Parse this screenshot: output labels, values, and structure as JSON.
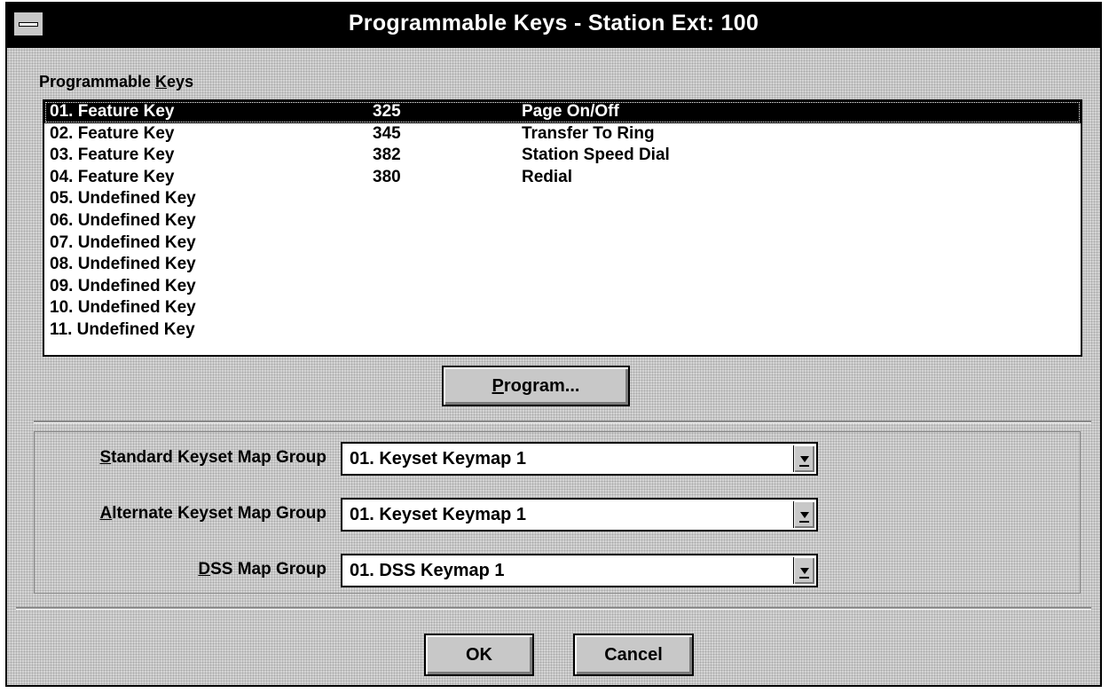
{
  "window": {
    "title": "Programmable Keys - Station Ext:  100"
  },
  "keys_group": {
    "label_prefix": "Programmable ",
    "label_mnemonic": "K",
    "label_suffix": "eys",
    "rows": [
      {
        "key": "01. Feature Key",
        "code": "325",
        "desc": "Page On/Off",
        "selected": true
      },
      {
        "key": "02. Feature Key",
        "code": "345",
        "desc": "Transfer To Ring"
      },
      {
        "key": "03. Feature Key",
        "code": "382",
        "desc": "Station Speed Dial"
      },
      {
        "key": "04. Feature Key",
        "code": "380",
        "desc": "Redial"
      },
      {
        "key": "05. Undefined Key",
        "code": "",
        "desc": ""
      },
      {
        "key": "06. Undefined Key",
        "code": "",
        "desc": ""
      },
      {
        "key": "07. Undefined Key",
        "code": "",
        "desc": ""
      },
      {
        "key": "08. Undefined Key",
        "code": "",
        "desc": ""
      },
      {
        "key": "09. Undefined Key",
        "code": "",
        "desc": ""
      },
      {
        "key": "10. Undefined Key",
        "code": "",
        "desc": ""
      },
      {
        "key": "11. Undefined Key",
        "code": "",
        "desc": ""
      }
    ],
    "program_button": {
      "mnemonic": "P",
      "rest": "rogram..."
    }
  },
  "map_groups": {
    "standard": {
      "mnemonic": "S",
      "rest": "tandard Keyset Map Group",
      "value": "01.  Keyset Keymap  1"
    },
    "alternate": {
      "mnemonic": "A",
      "rest": "lternate Keyset Map Group",
      "value": "01.  Keyset Keymap  1"
    },
    "dss": {
      "mnemonic": "D",
      "rest": "SS Map Group",
      "value": "01.  DSS Keymap  1"
    }
  },
  "buttons": {
    "ok": "OK",
    "cancel": "Cancel"
  }
}
